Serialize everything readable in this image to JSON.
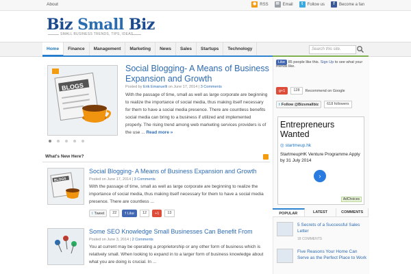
{
  "topbar": {
    "about": "About",
    "links": [
      {
        "label": "RSS",
        "icon": "rss-icon",
        "color": "#f39c12"
      },
      {
        "label": "Email",
        "icon": "email-icon",
        "color": "#9aa0a6"
      },
      {
        "label": "Follow us",
        "icon": "twitter-icon",
        "color": "#3aa9e0"
      },
      {
        "label": "Become a fan",
        "icon": "facebook-icon",
        "color": "#3b5998"
      }
    ]
  },
  "header": {
    "logo_part1": "Biz",
    "logo_part2": "Small",
    "logo_part3": "Biz",
    "tagline": "SMALL BUSINESS TRENDS, TIPS, IDEAS"
  },
  "nav": {
    "items": [
      "Home",
      "Finance",
      "Management",
      "Marketing",
      "News",
      "Sales",
      "Startups",
      "Technology"
    ],
    "search_placeholder": "Search this site."
  },
  "featured": {
    "title": "Social Blogging- A Means of Business Expansion and Growth",
    "meta_prefix": "Posted by",
    "author": "Erik Emanuelli",
    "date_text": "on June 17, 2014",
    "comments": "3 Comments",
    "text": "With the passage of time, small as well as large corporate are beginning to realize the importance of social media, thus making itself necessary for them to have a social media presence. There are countless benefits social media can bring to a business if utilized and implemented properly. The rising trend among web marketing services providers is of the use ...",
    "more": "Read more »"
  },
  "whats_new": {
    "title": "What's New Here?"
  },
  "posts": [
    {
      "title": "Social Blogging- A Means of Business Expansion and Growth",
      "date_text": "Posted on June 17, 2014",
      "comments": "3 Comments",
      "text": "With the passage of time, small as well as large corporate are beginning to realize the importance of social media, thus making itself necessary for them to have a social media presence. There are countless ...",
      "share": {
        "tweet": "Tweet",
        "tweet_count": "22",
        "like": "Like",
        "like_count": "12",
        "plus": "+1",
        "plus_count": "13"
      }
    },
    {
      "title": "Some SEO Knowledge Small Businesses Can Benefit From",
      "date_text": "Posted on June 3, 2014",
      "comments": "2 Comments",
      "text": "You at current may be operating a proprietorship or any other form of business which is relatively small. When looking to expand in to a larger form of business knowledge about what you are doing is crucial. In ..."
    }
  ],
  "sidebar": {
    "fb_like": "Like",
    "fb_text": "85 people like this.",
    "fb_signup": "Sign Up",
    "fb_text2": "to see what your friends like.",
    "gplus": "g+1",
    "gplus_count": "128",
    "gplus_text": "Recommend on Google",
    "twitter_follow": "Follow @Bizsmallbiz",
    "twitter_count": "618 followers",
    "ad_title": "Entrepreneurs Wanted",
    "ad_url": "startmeup.hk",
    "ad_text": "StartmeupHK Venture Programme Apply by 31 July 2014",
    "ad_choices": "AdChoices",
    "tabs": [
      "POPULAR",
      "LATEST",
      "COMMENTS"
    ],
    "popular": [
      {
        "title": "5 Secrets of a Successful Sales Letter",
        "count": "18 COMMENTS"
      },
      {
        "title": "Five Reasons Your Home Can Serve as the Perfect Place to Work",
        "count": ""
      }
    ]
  },
  "colors": {
    "accent": "#2c6ab1",
    "nav_active": "#1b74c5",
    "rss": "#f39c12"
  }
}
